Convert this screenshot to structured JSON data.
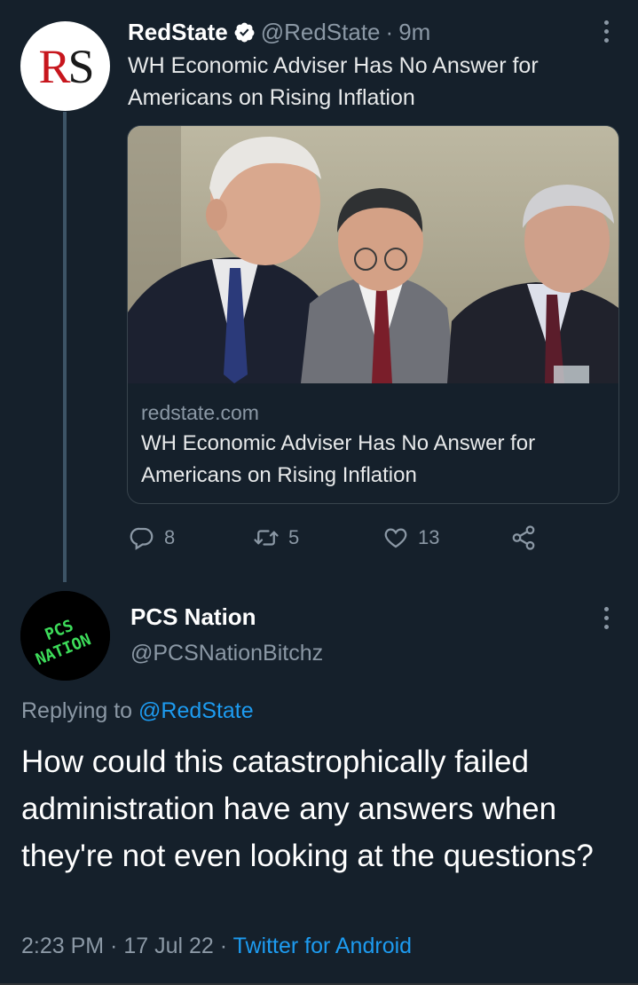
{
  "tweet1": {
    "avatar_text": {
      "r": "R",
      "s": "S"
    },
    "display_name": "RedState",
    "handle": "@RedState",
    "separator": "·",
    "time": "9m",
    "text": "WH Economic Adviser Has No Answer for Americans on Rising Inflation",
    "card": {
      "domain": "redstate.com",
      "title": "WH Economic Adviser Has No Answer for Americans on Rising Inflation"
    },
    "actions": {
      "replies": "8",
      "retweets": "5",
      "likes": "13"
    }
  },
  "tweet2": {
    "avatar_text": {
      "line1": "PCS",
      "line2": "NATION"
    },
    "display_name": "PCS Nation",
    "handle": "@PCSNationBitchz",
    "replying_prefix": "Replying to",
    "replying_mention": "@RedState",
    "text": "How could this catastrophically failed administration have any answers when they're not even looking at the questions?",
    "timestamp": "2:23 PM · 17 Jul 22",
    "separator": "·",
    "source": "Twitter for Android"
  },
  "colors": {
    "background": "#15202b",
    "secondary_text": "#8b98a5",
    "link": "#1d9bf0",
    "pcs_green": "#3ddc5a"
  }
}
